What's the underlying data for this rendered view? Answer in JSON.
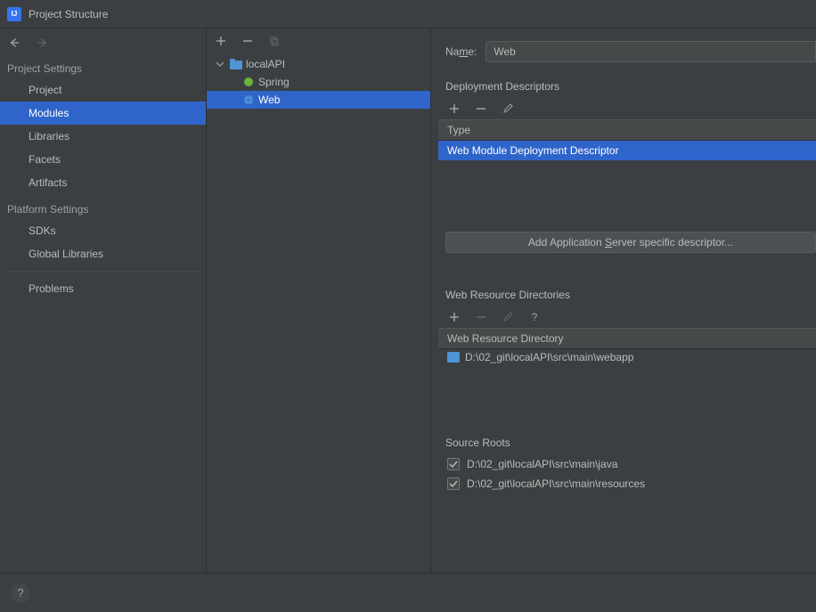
{
  "title": "Project Structure",
  "sidebar": {
    "sections": [
      {
        "title": "Project Settings",
        "items": [
          {
            "label": "Project",
            "selected": false
          },
          {
            "label": "Modules",
            "selected": true
          },
          {
            "label": "Libraries",
            "selected": false
          },
          {
            "label": "Facets",
            "selected": false
          },
          {
            "label": "Artifacts",
            "selected": false
          }
        ]
      },
      {
        "title": "Platform Settings",
        "items": [
          {
            "label": "SDKs",
            "selected": false
          },
          {
            "label": "Global Libraries",
            "selected": false
          }
        ]
      }
    ],
    "extra": [
      {
        "label": "Problems",
        "selected": false
      }
    ]
  },
  "tree": {
    "root": {
      "label": "localAPI",
      "expanded": true
    },
    "children": [
      {
        "label": "Spring",
        "selected": false,
        "icon": "spring"
      },
      {
        "label": "Web",
        "selected": true,
        "icon": "web"
      }
    ]
  },
  "right": {
    "name_label_pre": "Na",
    "name_label_u": "m",
    "name_label_post": "e:",
    "name_value": "Web",
    "dd_title": "Deployment Descriptors",
    "dd_header": "Type",
    "dd_rows": [
      "Web Module Deployment Descriptor"
    ],
    "btn_add_descriptor_pre": "Add Application ",
    "btn_add_descriptor_u": "S",
    "btn_add_descriptor_post": "erver specific descriptor...",
    "wrd_title": "Web Resource Directories",
    "wrd_header": "Web Resource Directory",
    "wrd_rows": [
      "D:\\02_git\\localAPI\\src\\main\\webapp"
    ],
    "src_title": "Source Roots",
    "src_rows": [
      {
        "label": "D:\\02_git\\localAPI\\src\\main\\java",
        "checked": true
      },
      {
        "label": "D:\\02_git\\localAPI\\src\\main\\resources",
        "checked": true
      }
    ]
  }
}
